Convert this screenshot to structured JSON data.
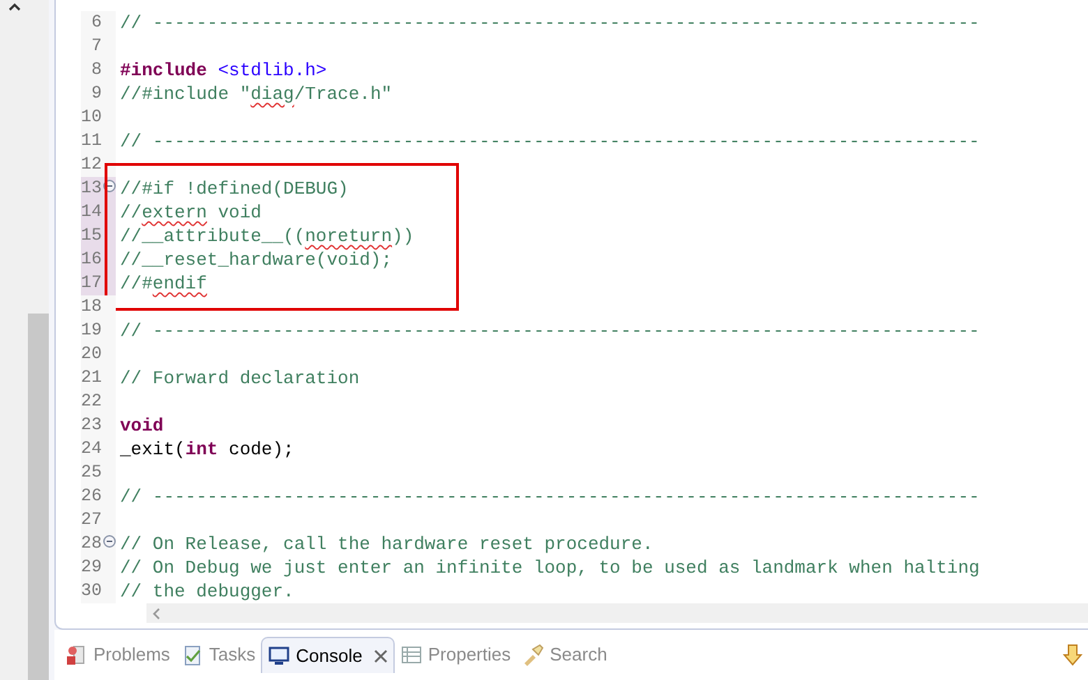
{
  "editor": {
    "lines": [
      {
        "number": "6",
        "marked": false,
        "foldable": false,
        "boxed": false,
        "segments": [
          {
            "text": "// ----------------------------------------------------------------------------",
            "kind": "comment"
          }
        ]
      },
      {
        "number": "7",
        "marked": false,
        "foldable": false,
        "boxed": false
      },
      {
        "number": "8",
        "marked": false,
        "foldable": false,
        "boxed": false,
        "segments": [
          {
            "text": "#include",
            "kind": "keyword"
          },
          {
            "text": " <stdlib.h>",
            "kind": "string"
          }
        ]
      },
      {
        "number": "9",
        "marked": false,
        "foldable": false,
        "boxed": false,
        "segments": [
          {
            "text": "//#include \"",
            "kind": "comment"
          },
          {
            "text": "diag",
            "kind": "misspelled"
          },
          {
            "text": "/Trace.h\"",
            "kind": "comment"
          }
        ]
      },
      {
        "number": "10",
        "marked": false,
        "foldable": false,
        "boxed": false
      },
      {
        "number": "11",
        "marked": false,
        "foldable": false,
        "boxed": false,
        "segments": [
          {
            "text": "// ----------------------------------------------------------------------------",
            "kind": "comment"
          }
        ]
      },
      {
        "number": "12",
        "marked": false,
        "foldable": false,
        "boxed": false
      },
      {
        "number": "13",
        "marked": true,
        "foldable": true,
        "boxed": true,
        "segments": [
          {
            "text": "//#if !defined(DEBUG)",
            "kind": "comment"
          }
        ]
      },
      {
        "number": "14",
        "marked": true,
        "foldable": false,
        "boxed": true,
        "segments": [
          {
            "text": "//",
            "kind": "comment"
          },
          {
            "text": "extern",
            "kind": "misspelled"
          },
          {
            "text": " void",
            "kind": "comment"
          }
        ]
      },
      {
        "number": "15",
        "marked": true,
        "foldable": false,
        "boxed": true,
        "segments": [
          {
            "text": "//__attribute__((",
            "kind": "comment"
          },
          {
            "text": "noreturn",
            "kind": "misspelled"
          },
          {
            "text": "))",
            "kind": "comment"
          }
        ]
      },
      {
        "number": "16",
        "marked": true,
        "foldable": false,
        "boxed": true,
        "segments": [
          {
            "text": "//__reset_hardware(void);",
            "kind": "comment"
          }
        ]
      },
      {
        "number": "17",
        "marked": true,
        "foldable": false,
        "boxed": true,
        "segments": [
          {
            "text": "//#",
            "kind": "comment"
          },
          {
            "text": "endif",
            "kind": "misspelled"
          }
        ]
      },
      {
        "number": "18",
        "marked": false,
        "foldable": false,
        "boxed": false
      },
      {
        "number": "19",
        "marked": false,
        "foldable": false,
        "boxed": false,
        "segments": [
          {
            "text": "// ----------------------------------------------------------------------------",
            "kind": "comment"
          }
        ]
      },
      {
        "number": "20",
        "marked": false,
        "foldable": false,
        "boxed": false
      },
      {
        "number": "21",
        "marked": false,
        "foldable": false,
        "boxed": false,
        "segments": [
          {
            "text": "// Forward declaration",
            "kind": "comment"
          }
        ]
      },
      {
        "number": "22",
        "marked": false,
        "foldable": false,
        "boxed": false
      },
      {
        "number": "23",
        "marked": false,
        "foldable": false,
        "boxed": false,
        "segments": [
          {
            "text": "void",
            "kind": "keyword"
          }
        ]
      },
      {
        "number": "24",
        "marked": false,
        "foldable": false,
        "boxed": false,
        "segments": [
          {
            "text": "_exit(",
            "kind": "plain"
          },
          {
            "text": "int",
            "kind": "keyword"
          },
          {
            "text": " code);",
            "kind": "plain"
          }
        ]
      },
      {
        "number": "25",
        "marked": false,
        "foldable": false,
        "boxed": false
      },
      {
        "number": "26",
        "marked": false,
        "foldable": false,
        "boxed": false,
        "segments": [
          {
            "text": "// ----------------------------------------------------------------------------",
            "kind": "comment"
          }
        ]
      },
      {
        "number": "27",
        "marked": false,
        "foldable": false,
        "boxed": false
      },
      {
        "number": "28",
        "marked": false,
        "foldable": true,
        "boxed": false,
        "segments": [
          {
            "text": "// On Release, call the hardware reset procedure.",
            "kind": "comment"
          }
        ]
      },
      {
        "number": "29",
        "marked": false,
        "foldable": false,
        "boxed": false,
        "segments": [
          {
            "text": "// On Debug we just enter an infinite loop, to be used as landmark when halting",
            "kind": "comment"
          }
        ]
      },
      {
        "number": "30",
        "marked": false,
        "foldable": false,
        "boxed": false,
        "segments": [
          {
            "text": "// the debugger.",
            "kind": "comment"
          }
        ]
      }
    ]
  },
  "bottom_tabs": [
    {
      "label": "Problems",
      "kind": "problems",
      "selected": false
    },
    {
      "label": "Tasks",
      "kind": "tasks",
      "selected": false
    },
    {
      "label": "Console",
      "kind": "console",
      "selected": true
    },
    {
      "label": "Properties",
      "kind": "properties",
      "selected": false
    },
    {
      "label": "Search",
      "kind": "search",
      "selected": false
    }
  ]
}
